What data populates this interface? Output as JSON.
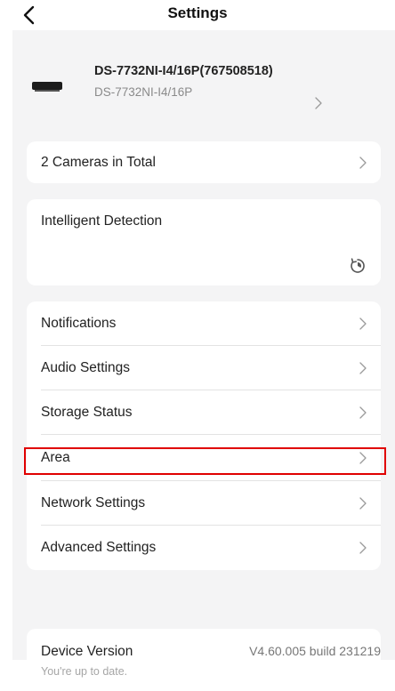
{
  "header": {
    "title": "Settings"
  },
  "device": {
    "name": "DS-7732NI-I4/16P(767508518)",
    "model": "DS-7732NI-I4/16P"
  },
  "cameras": {
    "label": "2 Cameras in Total"
  },
  "intelligent_detection": {
    "title": "Intelligent Detection"
  },
  "settings": {
    "items": [
      {
        "label": "Notifications"
      },
      {
        "label": "Audio Settings"
      },
      {
        "label": "Storage Status"
      },
      {
        "label": "Area"
      },
      {
        "label": "Network Settings"
      },
      {
        "label": "Advanced Settings"
      }
    ]
  },
  "version": {
    "label": "Device Version",
    "value": "V4.60.005 build 231219",
    "status": "You're up to date."
  },
  "colors": {
    "highlight": "#e00000",
    "background": "#f4f4f5",
    "card": "#ffffff"
  },
  "icons": {
    "back": "chevron-left-icon",
    "row_arrow": "chevron-right-icon",
    "refresh": "refresh-icon"
  }
}
